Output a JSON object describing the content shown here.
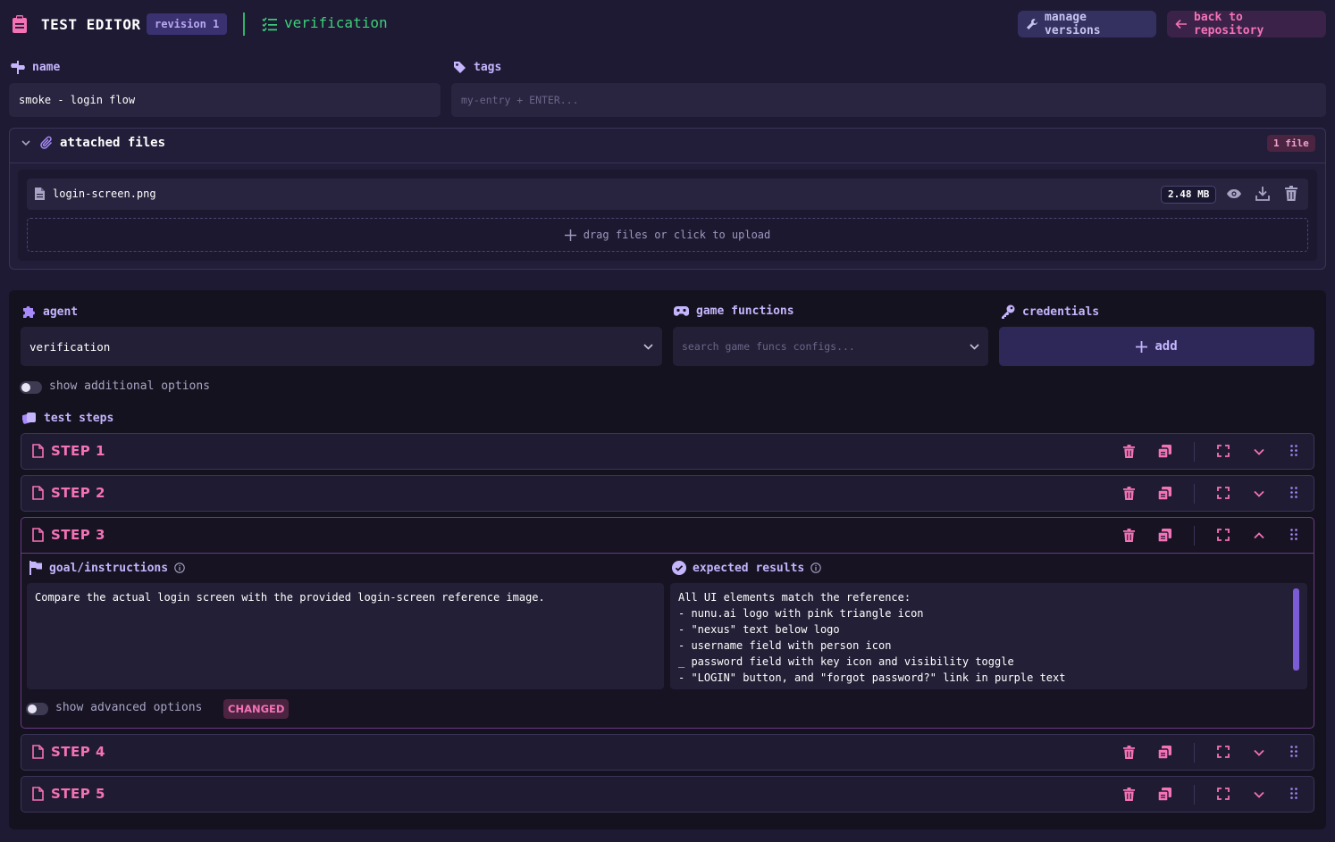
{
  "header": {
    "title": "TEST EDITOR",
    "revision_badge": "revision 1",
    "mode": "verification",
    "manage_versions": "manage versions",
    "back_to_repository": "back to repository"
  },
  "name_field": {
    "label": "name",
    "value": "smoke - login flow"
  },
  "tags_field": {
    "label": "tags",
    "placeholder": "my-entry + ENTER..."
  },
  "attached_files": {
    "title": "attached files",
    "count": "1 file",
    "files": [
      {
        "name": "login-screen.png",
        "size": "2.48 MB"
      }
    ],
    "dropzone": "drag files or click to upload"
  },
  "agent": {
    "label": "agent",
    "value": "verification"
  },
  "game_functions": {
    "label": "game functions",
    "placeholder": "search game funcs configs..."
  },
  "credentials": {
    "label": "credentials",
    "add_label": "add"
  },
  "additional_options": "show additional options",
  "test_steps": {
    "label": "test steps",
    "steps": [
      {
        "title": "STEP 1"
      },
      {
        "title": "STEP 2"
      },
      {
        "title": "STEP 3"
      },
      {
        "title": "STEP 4"
      },
      {
        "title": "STEP 5"
      }
    ],
    "open_step": {
      "goal_label": "goal/instructions",
      "goal_text": "Compare the actual login screen with the provided login-screen reference image.",
      "expected_label": "expected results",
      "expected_text": "All UI elements match the reference:\n- nunu.ai logo with pink triangle icon\n- \"nexus\" text below logo\n- username field with person icon\n_ password field with key icon and visibility toggle\n- \"LOGIN\" button, and \"forgot password?\" link in purple text",
      "advanced_options": "show advanced options",
      "changed_badge": "CHANGED"
    }
  },
  "colors": {
    "accent_pink": "#f472b6",
    "accent_purple": "#c4b5fd",
    "accent_green": "#3ecf7a"
  }
}
